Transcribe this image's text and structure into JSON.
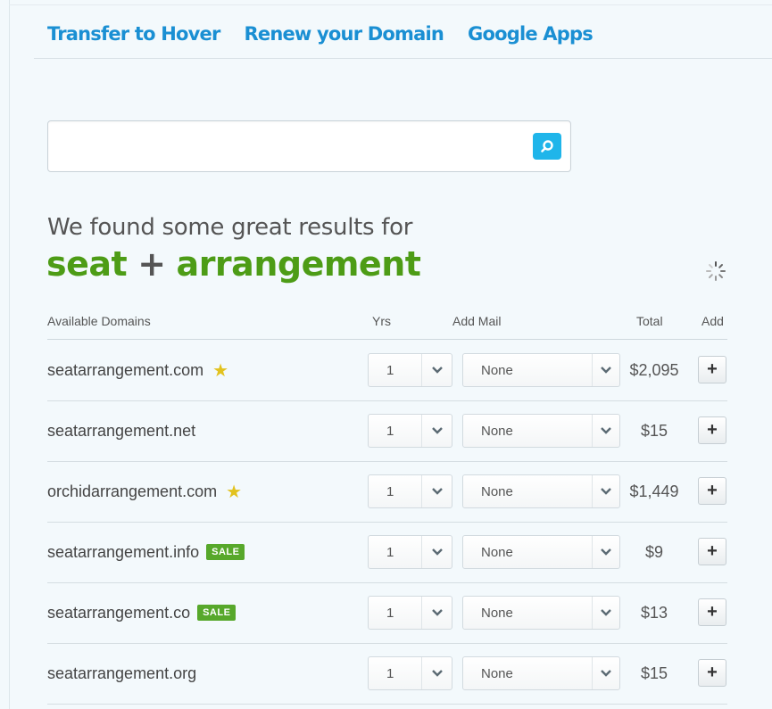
{
  "nav": {
    "links": [
      "Transfer to Hover",
      "Renew your Domain",
      "Google Apps"
    ]
  },
  "search": {
    "value": "",
    "placeholder": ""
  },
  "results": {
    "intro": "We found some great results for",
    "query_word_1": "seat",
    "query_plus": "+",
    "query_word_2": "arrangement"
  },
  "table": {
    "headers": {
      "domains": "Available Domains",
      "yrs": "Yrs",
      "mail": "Add Mail",
      "total": "Total",
      "add": "Add"
    },
    "rows": [
      {
        "domain": "seatarrangement.com",
        "star": "★",
        "sale": "",
        "yrs": "1",
        "mail": "None",
        "total": "$2,095",
        "add": "+"
      },
      {
        "domain": "seatarrangement.net",
        "star": "",
        "sale": "",
        "yrs": "1",
        "mail": "None",
        "total": "$15",
        "add": "+"
      },
      {
        "domain": "orchidarrangement.com",
        "star": "★",
        "sale": "",
        "yrs": "1",
        "mail": "None",
        "total": "$1,449",
        "add": "+"
      },
      {
        "domain": "seatarrangement.info",
        "star": "",
        "sale": "SALE",
        "yrs": "1",
        "mail": "None",
        "total": "$9",
        "add": "+"
      },
      {
        "domain": "seatarrangement.co",
        "star": "",
        "sale": "SALE",
        "yrs": "1",
        "mail": "None",
        "total": "$13",
        "add": "+"
      },
      {
        "domain": "seatarrangement.org",
        "star": "",
        "sale": "",
        "yrs": "1",
        "mail": "None",
        "total": "$15",
        "add": "+"
      }
    ]
  },
  "colors": {
    "link": "#1a8fd3",
    "query_green": "#4d9c16",
    "search_button": "#1fb5ea",
    "sale_badge": "#57a82b",
    "star": "#e2c21e"
  }
}
